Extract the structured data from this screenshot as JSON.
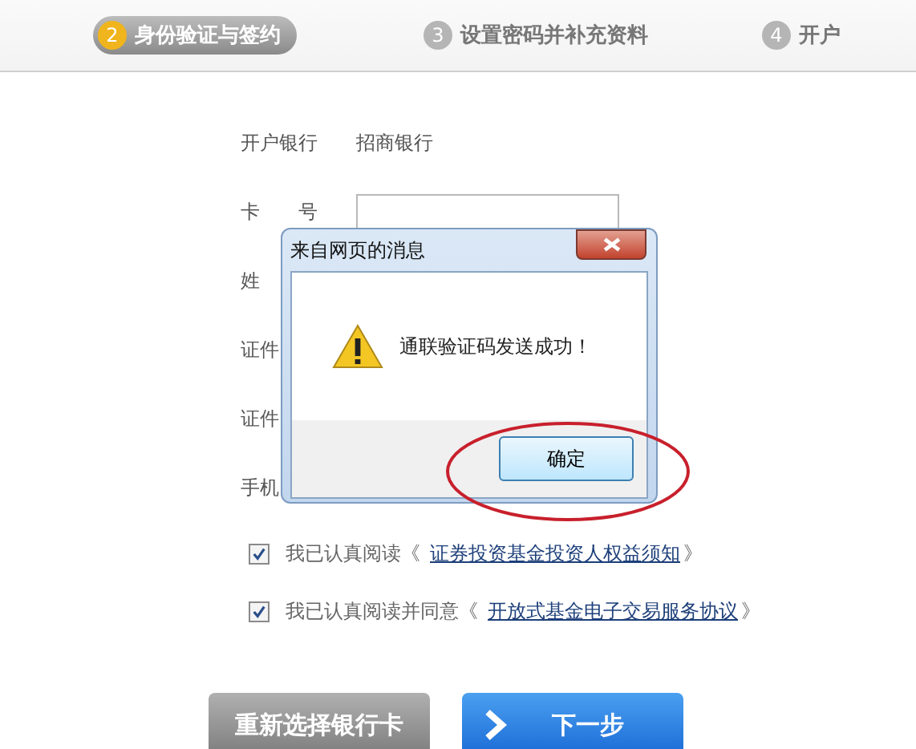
{
  "steps": [
    {
      "number": "2",
      "label": "身份验证与签约",
      "selected": true
    },
    {
      "number": "3",
      "label": "设置密码并补充资料",
      "selected": false
    },
    {
      "number": "4",
      "label": "开户",
      "selected": false
    }
  ],
  "form": {
    "rows": [
      {
        "kind": "text",
        "label": "开户银行",
        "value": "招商银行"
      },
      {
        "kind": "input",
        "label": "卡　　号"
      },
      {
        "kind": "label",
        "label": "姓"
      },
      {
        "kind": "label",
        "label": "证件"
      },
      {
        "kind": "label",
        "label": "证件"
      },
      {
        "kind": "label",
        "label": "手机"
      }
    ]
  },
  "agreements": [
    {
      "checked": true,
      "prefix": "我已认真阅读《",
      "link": "证券投资基金投资人权益须知",
      "suffix": "》"
    },
    {
      "checked": true,
      "prefix": "我已认真阅读并同意《",
      "link": "开放式基金电子交易服务协议",
      "suffix": "》"
    }
  ],
  "buttons": [
    {
      "kind": "secondary",
      "label": "重新选择银行卡"
    },
    {
      "kind": "primary",
      "label": "下一步"
    }
  ],
  "dialog": {
    "title": "来自网页的消息",
    "message": "通联验证码发送成功！",
    "ok": "确定",
    "highlighted": true
  }
}
